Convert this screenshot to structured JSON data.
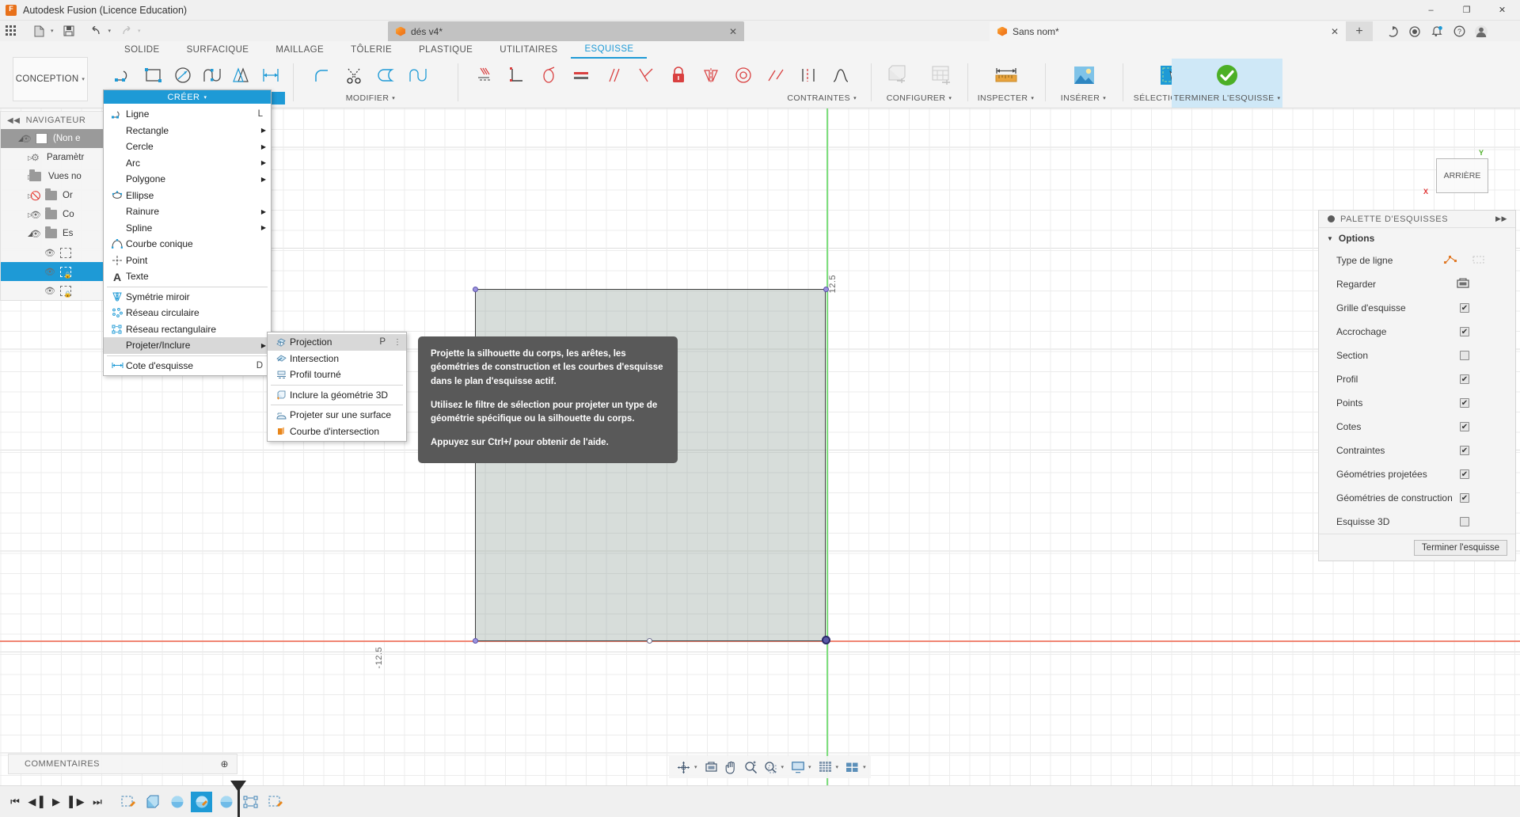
{
  "window": {
    "title": "Autodesk Fusion (Licence Education)",
    "minimize": "–",
    "maximize": "❐",
    "close": "✕"
  },
  "quickbar": {
    "grid_icon": "grid-icon",
    "new_icon": "new-document-icon",
    "save_icon": "save-icon",
    "undo_icon": "undo-icon",
    "redo_icon": "redo-icon"
  },
  "tabs": {
    "documents": [
      {
        "label": "dés v4*",
        "active": false,
        "close": "✕"
      },
      {
        "label": "Sans nom*",
        "active": true,
        "close": "✕"
      }
    ],
    "new_tab": "+"
  },
  "account_icons": {
    "extension": "extension-icon",
    "job_status": "job-status-icon",
    "notifications": "bell-icon",
    "help": "help-icon",
    "avatar": "user-avatar-icon"
  },
  "ribbon": {
    "workspace": "CONCEPTION",
    "workspace_caret": "▾",
    "tabs": [
      {
        "label": "SOLIDE",
        "active": false
      },
      {
        "label": "SURFACIQUE",
        "active": false
      },
      {
        "label": "MAILLAGE",
        "active": false
      },
      {
        "label": "TÔLERIE",
        "active": false
      },
      {
        "label": "PLASTIQUE",
        "active": false
      },
      {
        "label": "UTILITAIRES",
        "active": false
      },
      {
        "label": "ESQUISSE",
        "active": true
      }
    ],
    "panels": [
      {
        "label": "CRÉER",
        "highlight": true
      },
      {
        "label": "MODIFIER",
        "highlight": false
      },
      {
        "label": "CONTRAINTES",
        "highlight": false
      },
      {
        "label": "CONFIGURER",
        "highlight": false
      },
      {
        "label": "INSPECTER",
        "highlight": false
      },
      {
        "label": "INSÉRER",
        "highlight": false
      },
      {
        "label": "SÉLECTIONNER",
        "highlight": false
      },
      {
        "label": "TERMINER L'ESQUISSE",
        "highlight": false
      }
    ]
  },
  "navigator": {
    "title": "NAVIGATEUR",
    "collapse": "◀◀",
    "items": [
      {
        "label": "(Non e",
        "type": "component",
        "selected": true,
        "visible": true,
        "expanded": true
      },
      {
        "label": "Paramètr",
        "type": "gear",
        "visible": null,
        "expanded": false
      },
      {
        "label": "Vues no",
        "type": "folder",
        "visible": null,
        "expanded": false
      },
      {
        "label": "Or",
        "type": "folder",
        "visible": false,
        "expanded": false
      },
      {
        "label": "Co",
        "type": "folder",
        "visible": true,
        "expanded": false
      },
      {
        "label": "Es",
        "type": "folder",
        "visible": true,
        "expanded": true
      },
      {
        "label": "",
        "type": "sketch-edit",
        "visible": true
      },
      {
        "label": "",
        "type": "sketch-locked-active",
        "visible": true
      },
      {
        "label": "",
        "type": "sketch-locked",
        "visible": true
      }
    ]
  },
  "create_menu": {
    "header": "CRÉER",
    "header_caret": "▾",
    "items": [
      {
        "label": "Ligne",
        "shortcut": "L",
        "icon": "line-icon",
        "submenu": false
      },
      {
        "label": "Rectangle",
        "shortcut": "",
        "icon": "",
        "submenu": true
      },
      {
        "label": "Cercle",
        "shortcut": "",
        "icon": "",
        "submenu": true
      },
      {
        "label": "Arc",
        "shortcut": "",
        "icon": "",
        "submenu": true
      },
      {
        "label": "Polygone",
        "shortcut": "",
        "icon": "",
        "submenu": true
      },
      {
        "label": "Ellipse",
        "shortcut": "",
        "icon": "ellipse-icon",
        "submenu": false
      },
      {
        "label": "Rainure",
        "shortcut": "",
        "icon": "",
        "submenu": true
      },
      {
        "label": "Spline",
        "shortcut": "",
        "icon": "",
        "submenu": true
      },
      {
        "label": "Courbe conique",
        "shortcut": "",
        "icon": "conic-curve-icon",
        "submenu": false
      },
      {
        "label": "Point",
        "shortcut": "",
        "icon": "point-icon",
        "submenu": false
      },
      {
        "label": "Texte",
        "shortcut": "",
        "icon": "text-icon",
        "submenu": false
      },
      {
        "label": "Symétrie miroir",
        "shortcut": "",
        "icon": "mirror-icon",
        "submenu": false
      },
      {
        "label": "Réseau circulaire",
        "shortcut": "",
        "icon": "circular-pattern-icon",
        "submenu": false
      },
      {
        "label": "Réseau rectangulaire",
        "shortcut": "",
        "icon": "rectangular-pattern-icon",
        "submenu": false
      },
      {
        "label": "Projeter/Inclure",
        "shortcut": "",
        "icon": "",
        "submenu": true,
        "selected": true
      },
      {
        "label": "Cote d'esquisse",
        "shortcut": "D",
        "icon": "dimension-icon",
        "submenu": false
      }
    ]
  },
  "project_submenu": {
    "items": [
      {
        "label": "Projection",
        "shortcut": "P",
        "icon": "projection-icon",
        "selected": true,
        "overflow": "⋮"
      },
      {
        "label": "Intersection",
        "shortcut": "",
        "icon": "intersect-icon",
        "selected": false
      },
      {
        "label": "Profil tourné",
        "shortcut": "",
        "icon": "revolved-profile-icon",
        "selected": false
      },
      {
        "label": "Inclure la géométrie 3D",
        "shortcut": "",
        "icon": "include-3d-geometry-icon",
        "selected": false
      },
      {
        "label": "Projeter sur une surface",
        "shortcut": "",
        "icon": "project-to-surface-icon",
        "selected": false
      },
      {
        "label": "Courbe d'intersection",
        "shortcut": "",
        "icon": "intersection-curve-icon",
        "selected": false
      }
    ]
  },
  "tooltip": {
    "paragraph1": "Projette la silhouette du corps, les arêtes, les géométries de construction et les courbes d'esquisse dans le plan d'esquisse actif.",
    "paragraph2": "Utilisez le filtre de sélection pour projeter un type de géométrie spécifique ou la silhouette du corps.",
    "paragraph3": "Appuyez sur Ctrl+/ pour obtenir de l'aide."
  },
  "palette": {
    "title": "PALETTE D'ESQUISSES",
    "expand": "▶▶",
    "section": "Options",
    "section_tri": "▼",
    "rows": [
      {
        "label": "Type de ligne",
        "control": "icons",
        "checked": null
      },
      {
        "label": "Regarder",
        "control": "icon",
        "checked": null
      },
      {
        "label": "Grille d'esquisse",
        "control": "check",
        "checked": true
      },
      {
        "label": "Accrochage",
        "control": "check",
        "checked": true
      },
      {
        "label": "Section",
        "control": "check",
        "checked": false
      },
      {
        "label": "Profil",
        "control": "check",
        "checked": true
      },
      {
        "label": "Points",
        "control": "check",
        "checked": true
      },
      {
        "label": "Cotes",
        "control": "check",
        "checked": true
      },
      {
        "label": "Contraintes",
        "control": "check",
        "checked": true
      },
      {
        "label": "Géométries projetées",
        "control": "check",
        "checked": true
      },
      {
        "label": "Géométries de construction",
        "control": "check",
        "checked": true
      },
      {
        "label": "Esquisse 3D",
        "control": "check",
        "checked": false
      }
    ],
    "finish_button": "Terminer l'esquisse",
    "check_mark": "✔"
  },
  "canvas": {
    "dimension_top": "12.5",
    "dimension_bottom": "-12.5",
    "viewcube_label": "ARRIÈRE",
    "axis_x_label": "X",
    "axis_y_label": "Y",
    "axis_x_color": "#f08573",
    "axis_y_color": "#7ede7e"
  },
  "comments": {
    "title": "COMMENTAIRES",
    "add": "⊕"
  },
  "navbar": {
    "items": [
      "orbit-icon",
      "orbit-caret",
      "look-at-icon",
      "pan-icon",
      "zoom-icon",
      "zoom-window-icon",
      "zoom-window-caret",
      "display-settings-icon",
      "display-settings-caret",
      "grid-snaps-icon",
      "grid-snaps-caret",
      "viewports-icon",
      "viewports-caret"
    ]
  },
  "timeline": {
    "buttons": [
      "⏮",
      "◀▐",
      "▶",
      "▌▶",
      "⏭"
    ],
    "features": [
      {
        "name": "sketch-feature",
        "active": false
      },
      {
        "name": "extrude-feature",
        "active": false
      },
      {
        "name": "fillet-feature",
        "active": false
      },
      {
        "name": "sketch-edit-feature",
        "active": true
      },
      {
        "name": "sphere-feature",
        "active": false
      },
      {
        "name": "pattern-feature",
        "active": false
      },
      {
        "name": "sketch-feature-2",
        "active": false
      }
    ]
  },
  "colors": {
    "accent": "#1e9ad6",
    "brand_orange": "#e8711a",
    "finish_green": "#4caf26",
    "tooltip_bg": "#595959"
  }
}
